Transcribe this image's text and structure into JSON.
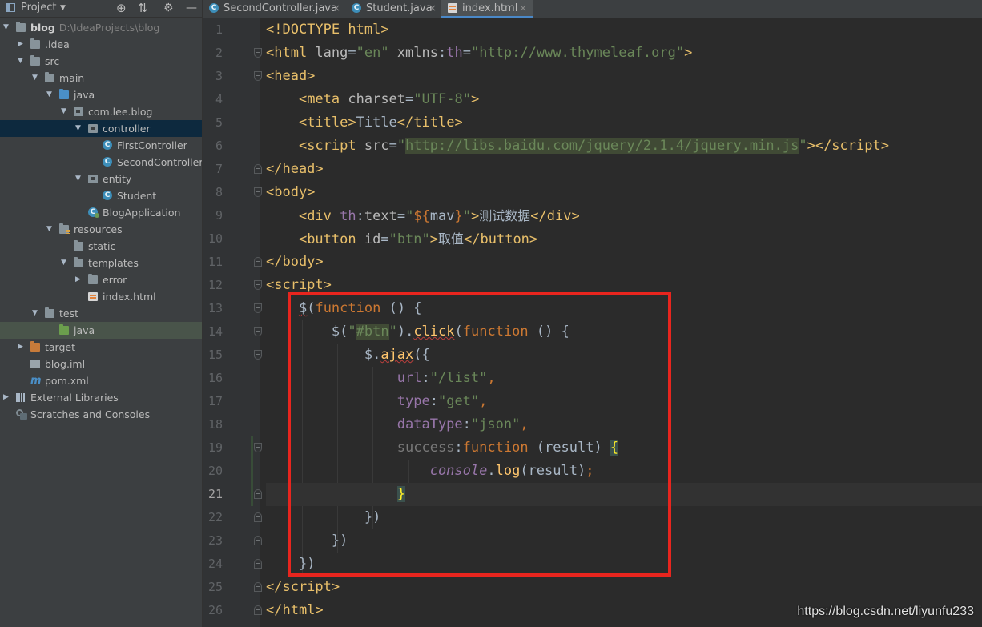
{
  "project_panel": {
    "title": "Project",
    "tree": [
      {
        "label": "blog",
        "path": "D:\\IdeaProjects\\blog",
        "bold": true
      },
      {
        "label": ".idea"
      },
      {
        "label": "src"
      },
      {
        "label": "main"
      },
      {
        "label": "java"
      },
      {
        "label": "com.lee.blog"
      },
      {
        "label": "controller"
      },
      {
        "label": "FirstController"
      },
      {
        "label": "SecondController"
      },
      {
        "label": "entity"
      },
      {
        "label": "Student"
      },
      {
        "label": "BlogApplication"
      },
      {
        "label": "resources"
      },
      {
        "label": "static"
      },
      {
        "label": "templates"
      },
      {
        "label": "error"
      },
      {
        "label": "index.html"
      },
      {
        "label": "test"
      },
      {
        "label": "java"
      },
      {
        "label": "target"
      },
      {
        "label": "blog.iml"
      },
      {
        "label": "pom.xml"
      },
      {
        "label": "External Libraries"
      },
      {
        "label": "Scratches and Consoles"
      }
    ]
  },
  "tabs": [
    {
      "label": "SecondController.java",
      "icon": "class-icon",
      "active": false
    },
    {
      "label": "Student.java",
      "icon": "class-icon",
      "active": false
    },
    {
      "label": "index.html",
      "icon": "html-file-icon",
      "active": true
    }
  ],
  "editor": {
    "current_line": 21,
    "line_count": 26
  },
  "watermark": "https://blog.csdn.net/liyunfu233",
  "colors": {
    "highlight_box": "#e8251e",
    "background": "#2b2b2b",
    "tag": "#e8bf6a",
    "string": "#6a8759",
    "keyword": "#cc7832"
  }
}
